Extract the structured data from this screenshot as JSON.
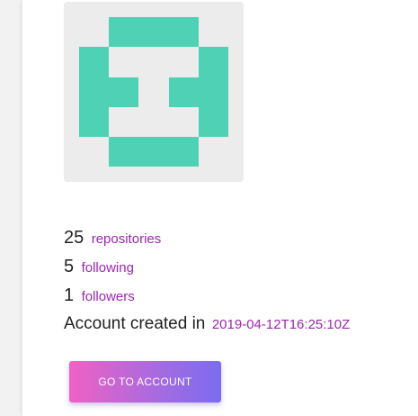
{
  "profile": {
    "avatar": {
      "icon": "identicon-icon",
      "background_color": "#ececec",
      "pattern_color": "#4fd1b5"
    },
    "stats": [
      {
        "count": "25",
        "label": "repositories"
      },
      {
        "count": "5",
        "label": "following"
      },
      {
        "count": "1",
        "label": "followers"
      }
    ],
    "created": {
      "text": "Account created in",
      "date": "2019-04-12T16:25:10Z"
    },
    "button_label": "GO TO ACCOUNT"
  },
  "colors": {
    "link": "#9c27b0",
    "button_gradient_start": "#f061c4",
    "button_gradient_end": "#7b6cf0"
  }
}
